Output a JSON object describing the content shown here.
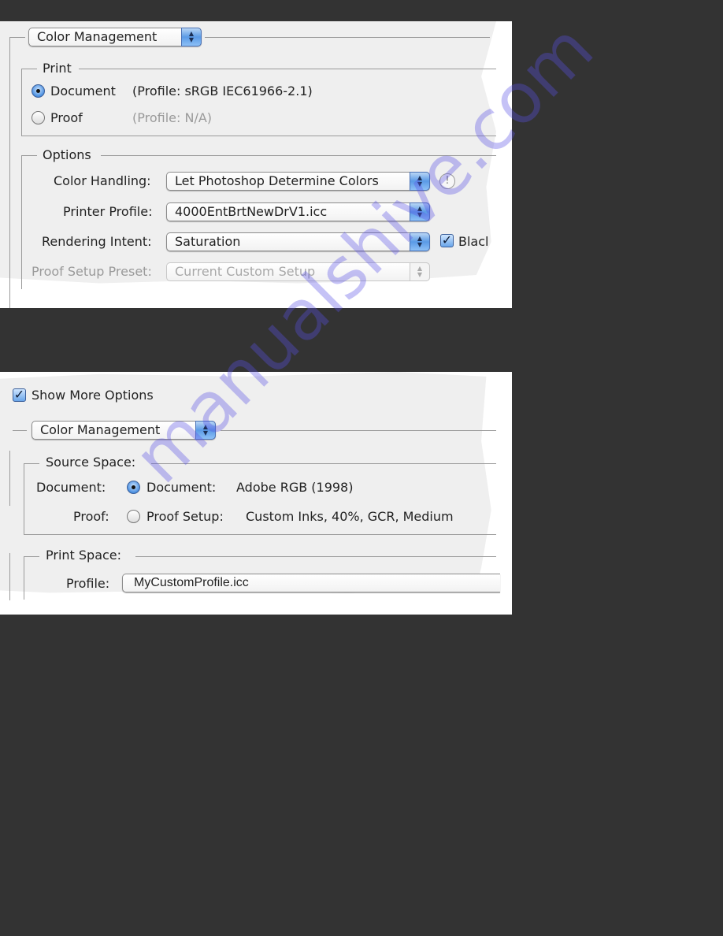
{
  "panel1": {
    "section_popup": "Color Management",
    "print_group": {
      "title": "Print",
      "document_label": "Document",
      "document_profile": "(Profile: sRGB IEC61966-2.1)",
      "proof_label": "Proof",
      "proof_profile": "(Profile: N/A)",
      "selected": "Document"
    },
    "options_group": {
      "title": "Options",
      "color_handling_label": "Color Handling:",
      "color_handling_value": "Let Photoshop Determine Colors",
      "printer_profile_label": "Printer Profile:",
      "printer_profile_value": "4000EntBrtNewDrV1.icc",
      "rendering_intent_label": "Rendering Intent:",
      "rendering_intent_value": "Saturation",
      "black_point_label": "Blacl",
      "black_point_checked": true,
      "proof_setup_label": "Proof Setup Preset:",
      "proof_setup_value": "Current Custom Setup",
      "warning_icon": "!"
    }
  },
  "panel2": {
    "show_more_options_label": "Show More Options",
    "show_more_options_checked": true,
    "section_popup": "Color Management",
    "source_space": {
      "title": "Source Space:",
      "document_row_label": "Document:",
      "document_option": "Document:",
      "document_value": "Adobe RGB (1998)",
      "proof_row_label": "Proof:",
      "proof_option": "Proof Setup:",
      "proof_value": "Custom Inks, 40%, GCR, Medium",
      "selected": "Document"
    },
    "print_space": {
      "title": "Print Space:",
      "profile_label": "Profile:",
      "profile_value": "MyCustomProfile.icc"
    }
  },
  "icons": {
    "popup_arrows_up": "▲",
    "popup_arrows_down": "▼",
    "checkmark": "✓"
  },
  "watermark": "manualshive.com",
  "colors": {
    "background": "#333333",
    "dialog": "#efefef",
    "accent_blue": "#5a9ae6",
    "watermark": "#5a50e6"
  }
}
